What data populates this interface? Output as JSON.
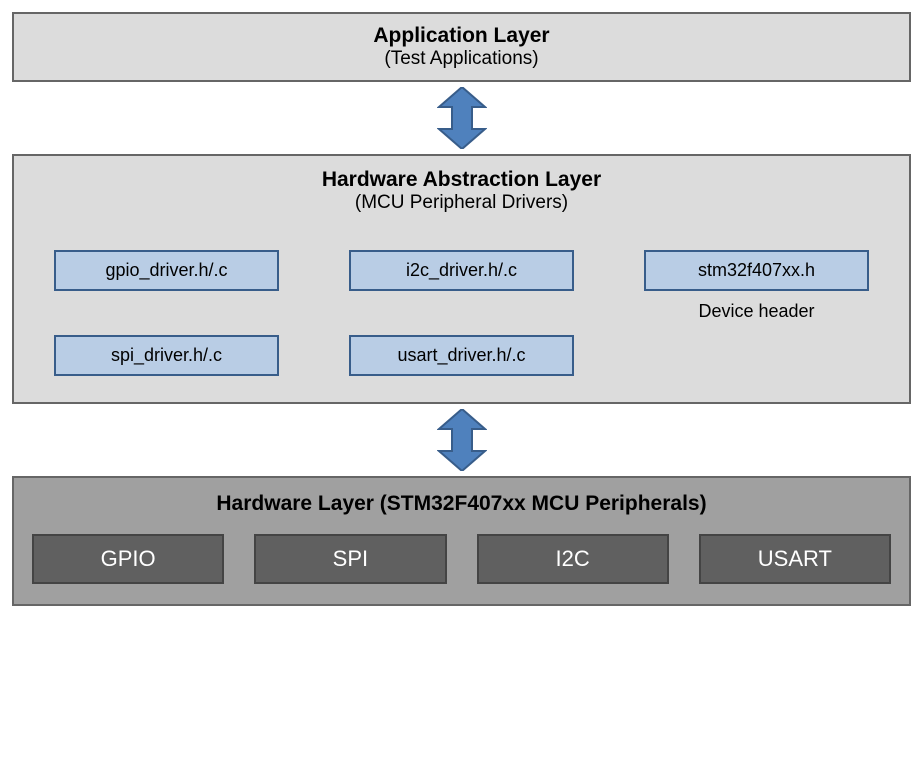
{
  "app_layer": {
    "title": "Application Layer",
    "subtitle": "(Test Applications)"
  },
  "hal_layer": {
    "title": "Hardware Abstraction Layer",
    "subtitle": "(MCU Peripheral Drivers)",
    "drivers": {
      "gpio": "gpio_driver.h/.c",
      "i2c": "i2c_driver.h/.c",
      "stm32": "stm32f407xx.h",
      "spi": "spi_driver.h/.c",
      "usart": "usart_driver.h/.c"
    },
    "device_header_caption": "Device header"
  },
  "hw_layer": {
    "title": "Hardware Layer (STM32F407xx MCU Peripherals)",
    "peripherals": {
      "gpio": "GPIO",
      "spi": "SPI",
      "i2c": "I2C",
      "usart": "USART"
    }
  }
}
